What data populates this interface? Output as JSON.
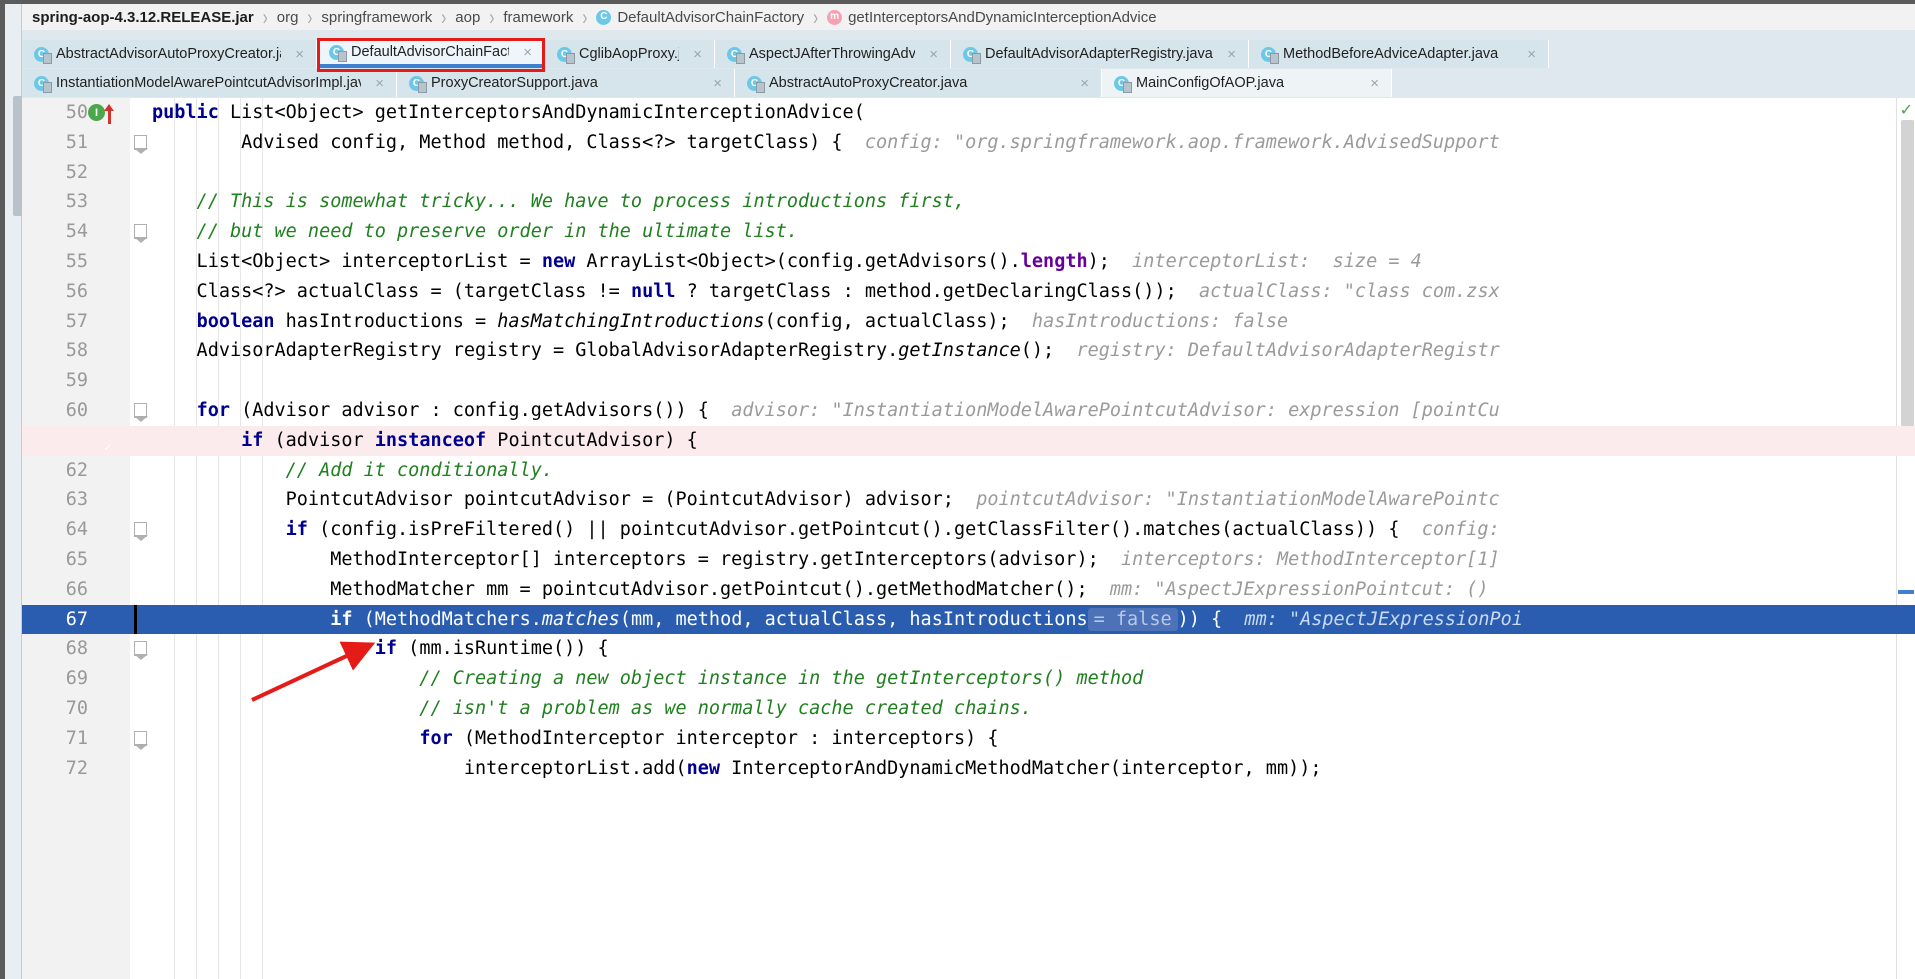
{
  "breadcrumb": {
    "items": [
      {
        "label": "spring-aop-4.3.12.RELEASE.jar",
        "bold": true,
        "icon": ""
      },
      {
        "label": "org",
        "bold": false,
        "icon": ""
      },
      {
        "label": "springframework",
        "bold": false,
        "icon": ""
      },
      {
        "label": "aop",
        "bold": false,
        "icon": ""
      },
      {
        "label": "framework",
        "bold": false,
        "icon": ""
      },
      {
        "label": "DefaultAdvisorChainFactory",
        "bold": false,
        "icon": "class-icon"
      },
      {
        "label": "getInterceptorsAndDynamicInterceptionAdvice",
        "bold": false,
        "icon": "method-icon"
      }
    ],
    "separator": "›"
  },
  "tabs": {
    "row1": [
      {
        "label": "AbstractAdvisorAutoProxyCreator.java",
        "active": false,
        "close": "×"
      },
      {
        "label": "DefaultAdvisorChainFactory.java",
        "active": true,
        "close": "×"
      },
      {
        "label": "CglibAopProxy.java",
        "active": false,
        "close": "×"
      },
      {
        "label": "AspectJAfterThrowingAdvice.java",
        "active": false,
        "close": "×"
      },
      {
        "label": "DefaultAdvisorAdapterRegistry.java",
        "active": false,
        "close": "×"
      },
      {
        "label": "MethodBeforeAdviceAdapter.java",
        "active": false,
        "close": "×"
      }
    ],
    "row2": [
      {
        "label": "InstantiationModelAwarePointcutAdvisorImpl.java",
        "active": false,
        "close": "×"
      },
      {
        "label": "ProxyCreatorSupport.java",
        "active": false,
        "close": "×"
      },
      {
        "label": "AbstractAutoProxyCreator.java",
        "active": false,
        "close": "×"
      },
      {
        "label": "MainConfigOfAOP.java",
        "active": false,
        "close": "×"
      }
    ]
  },
  "annotations": {
    "highlight_color": "#e41b17",
    "arrow_color": "#e41b17",
    "highlight_target": "DefaultAdvisorChainFactory.java",
    "arrow_target_line": 67
  },
  "editor": {
    "selected_line": 67,
    "breakpoint_line": 61,
    "run_marker_line": 50,
    "lines": [
      {
        "num": 50,
        "indent": 2,
        "tokens": [
          {
            "t": "public",
            "c": "kw"
          },
          {
            "t": " List<Object> getInterceptorsAndDynamicInterceptionAdvice(",
            "c": ""
          }
        ],
        "hint": ""
      },
      {
        "num": 51,
        "indent": 4,
        "tokens": [
          {
            "t": "        Advised config, Method method, Class<?> targetClass) {",
            "c": ""
          }
        ],
        "hint": "config: \"org.springframework.aop.framework.AdvisedSupport"
      },
      {
        "num": 52,
        "indent": 0,
        "tokens": [],
        "hint": ""
      },
      {
        "num": 53,
        "indent": 2,
        "tokens": [
          {
            "t": "    // This is somewhat tricky... We have to process introductions first,",
            "c": "cm"
          }
        ],
        "hint": ""
      },
      {
        "num": 54,
        "indent": 2,
        "tokens": [
          {
            "t": "    // but we need to preserve order in the ultimate list.",
            "c": "cm"
          }
        ],
        "hint": ""
      },
      {
        "num": 55,
        "indent": 2,
        "tokens": [
          {
            "t": "    List<Object> interceptorList = ",
            "c": ""
          },
          {
            "t": "new",
            "c": "kw"
          },
          {
            "t": " ArrayList<Object>(config.getAdvisors().",
            "c": ""
          },
          {
            "t": "length",
            "c": "fld"
          },
          {
            "t": ");",
            "c": ""
          }
        ],
        "hint": "interceptorList:  size = 4"
      },
      {
        "num": 56,
        "indent": 2,
        "tokens": [
          {
            "t": "    Class<?> actualClass = (targetClass != ",
            "c": ""
          },
          {
            "t": "null",
            "c": "kw"
          },
          {
            "t": " ? targetClass : method.getDeclaringClass());",
            "c": ""
          }
        ],
        "hint": "actualClass: \"class com.zsx"
      },
      {
        "num": 57,
        "indent": 2,
        "tokens": [
          {
            "t": "    ",
            "c": ""
          },
          {
            "t": "boolean",
            "c": "kw"
          },
          {
            "t": " hasIntroductions = ",
            "c": ""
          },
          {
            "t": "hasMatchingIntroductions",
            "c": "mth"
          },
          {
            "t": "(config, actualClass);",
            "c": ""
          }
        ],
        "hint": "hasIntroductions: false"
      },
      {
        "num": 58,
        "indent": 2,
        "tokens": [
          {
            "t": "    AdvisorAdapterRegistry registry = GlobalAdvisorAdapterRegistry.",
            "c": ""
          },
          {
            "t": "getInstance",
            "c": "mth"
          },
          {
            "t": "();",
            "c": ""
          }
        ],
        "hint": "registry: DefaultAdvisorAdapterRegistr"
      },
      {
        "num": 59,
        "indent": 0,
        "tokens": [],
        "hint": ""
      },
      {
        "num": 60,
        "indent": 2,
        "tokens": [
          {
            "t": "    ",
            "c": ""
          },
          {
            "t": "for",
            "c": "kw"
          },
          {
            "t": " (Advisor advisor : config.getAdvisors()) {",
            "c": ""
          }
        ],
        "hint": "advisor: \"InstantiationModelAwarePointcutAdvisor: expression [pointCu"
      },
      {
        "num": 61,
        "indent": 3,
        "tokens": [
          {
            "t": "        ",
            "c": ""
          },
          {
            "t": "if",
            "c": "kw"
          },
          {
            "t": " (advisor ",
            "c": ""
          },
          {
            "t": "instanceof",
            "c": "kw"
          },
          {
            "t": " PointcutAdvisor) {",
            "c": ""
          }
        ],
        "hint": ""
      },
      {
        "num": 62,
        "indent": 4,
        "tokens": [
          {
            "t": "            // Add it conditionally.",
            "c": "cm"
          }
        ],
        "hint": ""
      },
      {
        "num": 63,
        "indent": 4,
        "tokens": [
          {
            "t": "            PointcutAdvisor pointcutAdvisor = (PointcutAdvisor) advisor;",
            "c": ""
          }
        ],
        "hint": "pointcutAdvisor: \"InstantiationModelAwarePointc"
      },
      {
        "num": 64,
        "indent": 4,
        "tokens": [
          {
            "t": "            ",
            "c": ""
          },
          {
            "t": "if",
            "c": "kw"
          },
          {
            "t": " (config.isPreFiltered() || pointcutAdvisor.getPointcut().getClassFilter().matches(actualClass)) {",
            "c": ""
          }
        ],
        "hint": "config:"
      },
      {
        "num": 65,
        "indent": 5,
        "tokens": [
          {
            "t": "                MethodInterceptor[] interceptors = registry.getInterceptors(advisor);",
            "c": ""
          }
        ],
        "hint": "interceptors: MethodInterceptor[1]"
      },
      {
        "num": 66,
        "indent": 5,
        "tokens": [
          {
            "t": "                MethodMatcher mm = pointcutAdvisor.getPointcut().getMethodMatcher();",
            "c": ""
          }
        ],
        "hint": "mm: \"AspectJExpressionPointcut: () "
      },
      {
        "num": 67,
        "indent": 5,
        "tokens": [
          {
            "t": "                ",
            "c": ""
          },
          {
            "t": "if",
            "c": "kw"
          },
          {
            "t": " (MethodMatchers.",
            "c": ""
          },
          {
            "t": "matches",
            "c": "mth"
          },
          {
            "t": "(mm, method, actualClass, hasIntroductions",
            "c": ""
          },
          {
            "t": "= false",
            "c": "badge"
          },
          {
            "t": ")) {",
            "c": ""
          }
        ],
        "hint": "mm: \"AspectJExpressionPoi"
      },
      {
        "num": 68,
        "indent": 6,
        "tokens": [
          {
            "t": "                    ",
            "c": ""
          },
          {
            "t": "if",
            "c": "kw"
          },
          {
            "t": " (mm.isRuntime()) {",
            "c": ""
          }
        ],
        "hint": ""
      },
      {
        "num": 69,
        "indent": 7,
        "tokens": [
          {
            "t": "                        // Creating a new object instance in the getInterceptors() method",
            "c": "cm"
          }
        ],
        "hint": ""
      },
      {
        "num": 70,
        "indent": 7,
        "tokens": [
          {
            "t": "                        // isn't a problem as we normally cache created chains.",
            "c": "cm"
          }
        ],
        "hint": ""
      },
      {
        "num": 71,
        "indent": 7,
        "tokens": [
          {
            "t": "                        ",
            "c": ""
          },
          {
            "t": "for",
            "c": "kw"
          },
          {
            "t": " (MethodInterceptor interceptor : interceptors) {",
            "c": ""
          }
        ],
        "hint": ""
      },
      {
        "num": 72,
        "indent": 8,
        "tokens": [
          {
            "t": "                            interceptorList.add(",
            "c": ""
          },
          {
            "t": "new",
            "c": "kw"
          },
          {
            "t": " InterceptorAndDynamicMethodMatcher(interceptor, mm));",
            "c": ""
          }
        ],
        "hint": ""
      }
    ],
    "gutter": {
      "run_icon": "I",
      "breakpoint_icon": "✓",
      "up_arrow_icon": "arrow-up-icon"
    },
    "status_check": "✓"
  },
  "colors": {
    "selection_blue": "#2a5db0",
    "breakpoint_row": "#fbebed",
    "keyword": "#00008f",
    "comment": "#208020",
    "field": "#660099",
    "hint_gray": "#9a9a9a",
    "tab_active_underline": "#3e7fd0"
  }
}
